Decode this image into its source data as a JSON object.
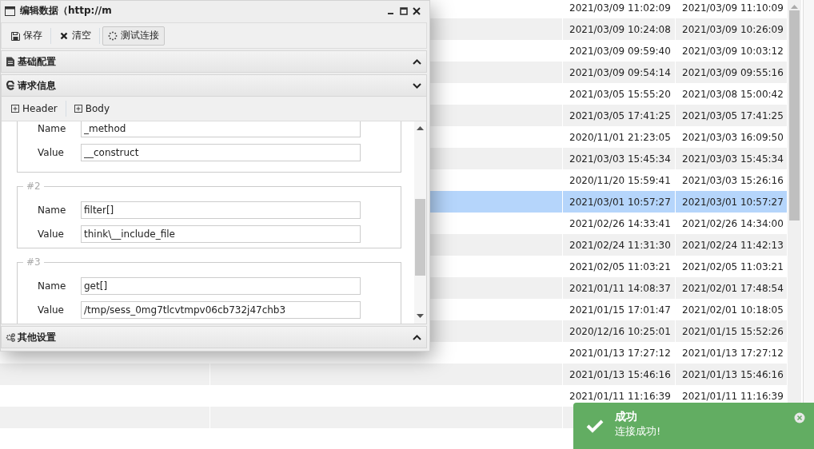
{
  "dialog": {
    "title": "编辑数据（http://m",
    "toolbar": [
      {
        "kind": "save",
        "label": "保存",
        "focused": false
      },
      {
        "kind": "clear",
        "label": "清空",
        "focused": false
      },
      {
        "kind": "test",
        "label": "测试连接",
        "focused": true
      }
    ],
    "panels": [
      {
        "kind": "file",
        "title": "基础配置",
        "expanded": false
      },
      {
        "kind": "ie",
        "title": "请求信息",
        "expanded": true
      }
    ],
    "request_tabs": [
      {
        "label": "Header"
      },
      {
        "label": "Body"
      }
    ],
    "fieldsets": [
      {
        "fields": [
          {
            "label": "Name",
            "value": "_method"
          },
          {
            "label": "Value",
            "value": "__construct"
          }
        ]
      },
      {
        "legend": "#2",
        "fields": [
          {
            "label": "Name",
            "value": "filter[]"
          },
          {
            "label": "Value",
            "value": "think\\__include_file"
          }
        ]
      },
      {
        "legend": "#3",
        "fields": [
          {
            "label": "Name",
            "value": "get[]"
          },
          {
            "label": "Value",
            "value": "/tmp/sess_0mg7tlcvtmpv06cb732j47chb3"
          }
        ]
      }
    ],
    "bottom_panel": {
      "kind": "gears",
      "title": "其他设置",
      "expanded": false
    }
  },
  "table": {
    "rows": [
      {
        "cells": [
          "2021/03/09 11:02:09",
          "2021/03/09 11:10:09"
        ],
        "selected": false
      },
      {
        "cells": [
          "2021/03/09 10:24:08",
          "2021/03/09 10:26:09"
        ],
        "selected": false
      },
      {
        "cells": [
          "2021/03/09 09:59:40",
          "2021/03/09 10:03:12"
        ],
        "selected": false
      },
      {
        "cells": [
          "2021/03/09 09:54:14",
          "2021/03/09 09:55:16"
        ],
        "selected": false
      },
      {
        "cells": [
          "2021/03/05 15:55:20",
          "2021/03/08 15:00:42"
        ],
        "selected": false
      },
      {
        "cells": [
          "2021/03/05 17:41:25",
          "2021/03/05 17:41:25"
        ],
        "selected": false
      },
      {
        "cells": [
          "2020/11/01 21:23:05",
          "2021/03/03 16:09:50"
        ],
        "selected": false
      },
      {
        "cells": [
          "2021/03/03 15:45:34",
          "2021/03/03 15:45:34"
        ],
        "selected": false
      },
      {
        "cells": [
          "2020/11/20 15:59:41",
          "2021/03/03 15:26:16"
        ],
        "selected": false
      },
      {
        "cells": [
          "2021/03/01 10:57:27",
          "2021/03/01 10:57:27"
        ],
        "selected": true
      },
      {
        "cells": [
          "2021/02/26 14:33:41",
          "2021/02/26 14:34:00"
        ],
        "selected": false
      },
      {
        "cells": [
          "2021/02/24 11:31:30",
          "2021/02/24 11:42:13"
        ],
        "selected": false
      },
      {
        "cells": [
          "2021/02/05 11:03:21",
          "2021/02/05 11:03:21"
        ],
        "selected": false
      },
      {
        "cells": [
          "2021/01/11 14:08:37",
          "2021/02/01 17:48:54"
        ],
        "selected": false
      },
      {
        "cells": [
          "2021/01/15 17:01:47",
          "2021/02/01 10:18:05"
        ],
        "selected": false
      },
      {
        "cells": [
          "2020/12/16 10:25:01",
          "2021/01/15 15:52:26"
        ],
        "selected": false
      },
      {
        "cells": [
          "2021/01/13 17:27:12",
          "2021/01/13 17:27:12"
        ],
        "selected": false
      },
      {
        "cells": [
          "2021/01/13 15:46:16",
          "2021/01/13 15:46:16"
        ],
        "selected": false
      },
      {
        "cells": [
          "2021/01/11 11:16:39",
          "2021/01/11 11:16:39"
        ],
        "selected": false
      },
      {
        "selected": false
      }
    ]
  },
  "toast": {
    "title": "成功",
    "message": "连接成功!"
  }
}
